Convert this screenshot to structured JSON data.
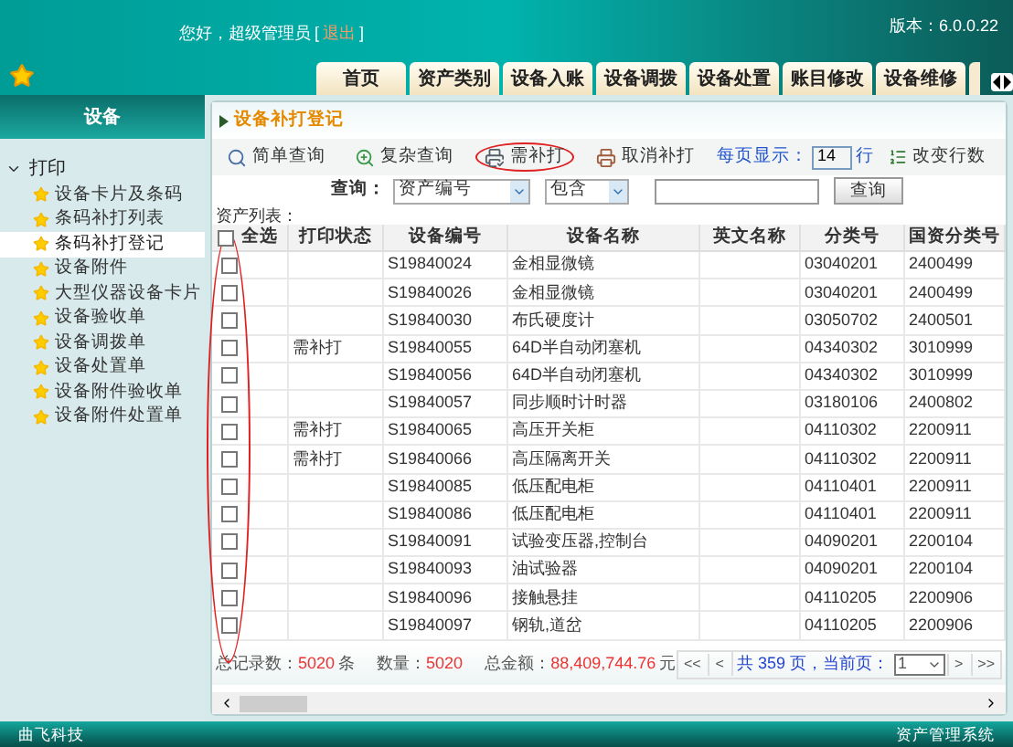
{
  "header": {
    "greeting": "您好，超级管理员",
    "logout_open": "[",
    "logout": "退出",
    "logout_close": "]",
    "version": "版本：6.0.0.22"
  },
  "tabs": [
    {
      "label": "首页",
      "selected": false
    },
    {
      "label": "资产类别",
      "selected": false
    },
    {
      "label": "设备入账",
      "selected": false
    },
    {
      "label": "设备调拨",
      "selected": false
    },
    {
      "label": "设备处置",
      "selected": false
    },
    {
      "label": "账目修改",
      "selected": false
    },
    {
      "label": "设备维修",
      "selected": false
    }
  ],
  "sidebar": {
    "title": "设备",
    "items": [
      {
        "label": "打印",
        "expanded": true,
        "children": [
          {
            "label": "设备卡片及条码",
            "selected": false
          },
          {
            "label": "条码补打列表",
            "selected": false
          },
          {
            "label": "条码补打登记",
            "selected": true
          },
          {
            "label": "设备附件",
            "selected": false
          },
          {
            "label": "大型仪器设备卡片",
            "selected": false
          },
          {
            "label": "设备验收单",
            "selected": false
          },
          {
            "label": "设备调拨单",
            "selected": false
          },
          {
            "label": "设备处置单",
            "selected": false
          },
          {
            "label": "设备附件验收单",
            "selected": false
          },
          {
            "label": "设备附件处置单",
            "selected": false
          }
        ]
      }
    ]
  },
  "panel": {
    "title": "设备补打登记"
  },
  "toolbar": {
    "buttons": [
      {
        "kind": "search",
        "label": "简单查询",
        "circled": false
      },
      {
        "kind": "advanced",
        "label": "复杂查询",
        "circled": false
      },
      {
        "kind": "print",
        "label": "需补打",
        "circled": true
      },
      {
        "kind": "cancel",
        "label": "取消补打",
        "circled": false
      }
    ],
    "page_size_label": "每页显示：",
    "page_size": "14",
    "page_size_unit": "行",
    "change_rows": "改变行数"
  },
  "query": {
    "label": "查询：",
    "field": "资产编号",
    "operator": "包含",
    "button": "查询"
  },
  "table": {
    "caption": "资产列表：",
    "select_all": "全选",
    "select_all_checked": false,
    "checkbox_column_circled": true,
    "columns": [
      "打印状态",
      "设备编号",
      "设备名称",
      "英文名称",
      "分类号",
      "国资分类号"
    ],
    "rows": [
      {
        "checked": false,
        "cells": [
          "",
          "S19840024",
          "金相显微镜",
          "",
          "03040201",
          "2400499"
        ]
      },
      {
        "checked": false,
        "cells": [
          "",
          "S19840026",
          "金相显微镜",
          "",
          "03040201",
          "2400499"
        ]
      },
      {
        "checked": false,
        "cells": [
          "",
          "S19840030",
          "布氏硬度计",
          "",
          "03050702",
          "2400501"
        ]
      },
      {
        "checked": false,
        "cells": [
          "需补打",
          "S19840055",
          "64D半自动闭塞机",
          "",
          "04340302",
          "3010999"
        ]
      },
      {
        "checked": false,
        "cells": [
          "",
          "S19840056",
          "64D半自动闭塞机",
          "",
          "04340302",
          "3010999"
        ]
      },
      {
        "checked": false,
        "cells": [
          "",
          "S19840057",
          "同步顺时计时器",
          "",
          "03180106",
          "2400802"
        ]
      },
      {
        "checked": false,
        "cells": [
          "需补打",
          "S19840065",
          "高压开关柜",
          "",
          "04110302",
          "2200911"
        ]
      },
      {
        "checked": false,
        "cells": [
          "需补打",
          "S19840066",
          "高压隔离开关",
          "",
          "04110302",
          "2200911"
        ]
      },
      {
        "checked": false,
        "cells": [
          "",
          "S19840085",
          "低压配电柜",
          "",
          "04110401",
          "2200911"
        ]
      },
      {
        "checked": false,
        "cells": [
          "",
          "S19840086",
          "低压配电柜",
          "",
          "04110401",
          "2200911"
        ]
      },
      {
        "checked": false,
        "cells": [
          "",
          "S19840091",
          "试验变压器,控制台",
          "",
          "04090201",
          "2200104"
        ]
      },
      {
        "checked": false,
        "cells": [
          "",
          "S19840093",
          "油试验器",
          "",
          "04090201",
          "2200104"
        ]
      },
      {
        "checked": false,
        "cells": [
          "",
          "S19840096",
          "接触悬挂",
          "",
          "04110205",
          "2200906"
        ]
      },
      {
        "checked": false,
        "cells": [
          "",
          "S19840097",
          "钢轨,道岔",
          "",
          "04110205",
          "2200906"
        ]
      }
    ]
  },
  "summary": {
    "total_label": "总记录数：",
    "total": "5020",
    "total_unit": "条",
    "qty_label": "数量：",
    "qty": "5020",
    "amount_label": "总金额：",
    "amount": "88,409,744.76",
    "amount_unit": "元"
  },
  "pager": {
    "first": "<<",
    "prev": "<",
    "info": "共 359 页，当前页：",
    "page": "1",
    "next": ">",
    "last": ">>"
  },
  "footer": {
    "left": "曲飞科技",
    "right": "资产管理系统"
  }
}
